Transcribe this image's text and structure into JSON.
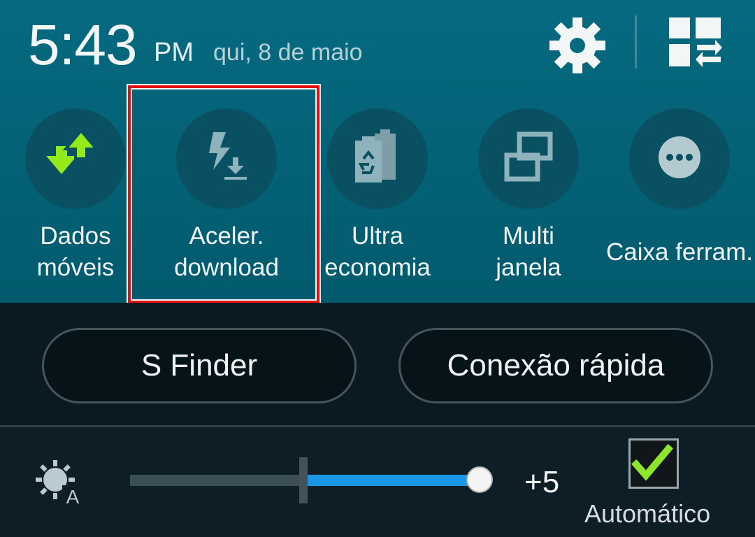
{
  "status": {
    "time": "5:43",
    "ampm": "PM",
    "date": "qui, 8 de maio"
  },
  "header_icons": [
    "gear-icon",
    "grid-swap-icon"
  ],
  "toggles": [
    {
      "label": "Dados móveis",
      "line1": "Dados",
      "line2": "móveis",
      "icon": "mobile-data-icon"
    },
    {
      "label": "Aceler. download",
      "line1": "Aceler.",
      "line2": "download",
      "icon": "download-booster-icon",
      "highlighted": true
    },
    {
      "label": "Ultra economia",
      "line1": "Ultra",
      "line2": "economia",
      "icon": "ultra-power-saving-icon"
    },
    {
      "label": "Multi janela",
      "line1": "Multi",
      "line2": "janela",
      "icon": "multi-window-icon"
    },
    {
      "label": "Caixa ferram.",
      "line1": "Caixa ferram.",
      "icon": "toolbox-icon"
    }
  ],
  "buttons": {
    "s_finder": "S Finder",
    "quick_connect": "Conexão rápida"
  },
  "brightness": {
    "value_label": "+5",
    "level": 1.0,
    "auto_label": "Automático",
    "auto_checked": true
  },
  "colors": {
    "panel": "#066a80",
    "accent_green": "#8ee62a",
    "slider_blue": "#1a96e6",
    "highlight_red": "#e01212"
  }
}
